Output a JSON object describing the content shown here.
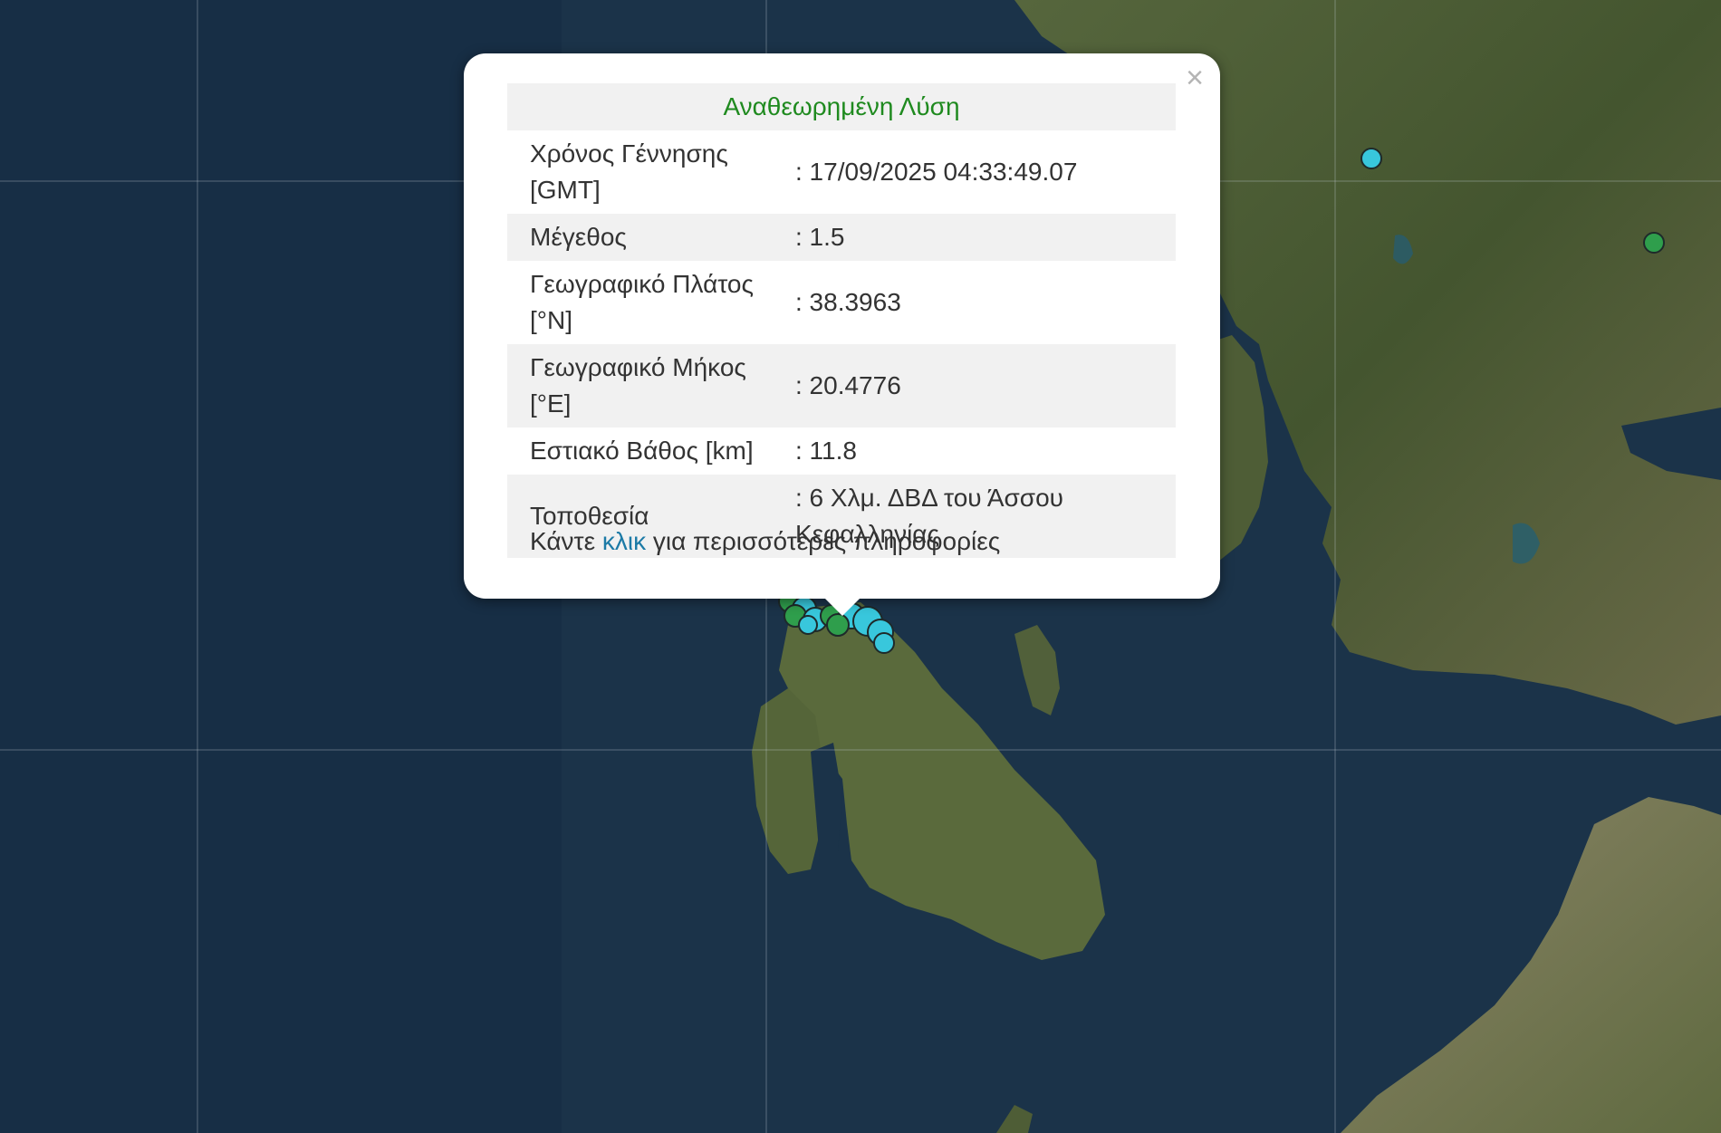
{
  "popup": {
    "title": "Αναθεωρημένη Λύση",
    "close_symbol": "×",
    "rows": [
      {
        "label": "Χρόνος Γέννησης [GMT]",
        "value": ": 17/09/2025 04:33:49.07"
      },
      {
        "label": "Μέγεθος",
        "value": ": 1.5"
      },
      {
        "label": "Γεωγραφικό Πλάτος [°N]",
        "value": ": 38.3963"
      },
      {
        "label": "Γεωγραφικό Μήκος [°E]",
        "value": ": 20.4776"
      },
      {
        "label": "Εστιακό Βάθος [km]",
        "value": ": 11.8"
      },
      {
        "label": "Τοποθεσία",
        "value": ": 6 Χλμ. ΔΒΔ του Άσσου Κεφαλληνίας"
      }
    ],
    "more_prefix": "Κάντε ",
    "more_link": "κλικ",
    "more_suffix": " για περισσότερες πληροφορίες"
  },
  "colors": {
    "sea": "#1b3349",
    "land": "#4a5a36",
    "marker_cyan": "#38c7dc",
    "marker_green": "#2f9e4c",
    "title_green": "#1f8a1f",
    "link_blue": "#1c7aa6"
  }
}
